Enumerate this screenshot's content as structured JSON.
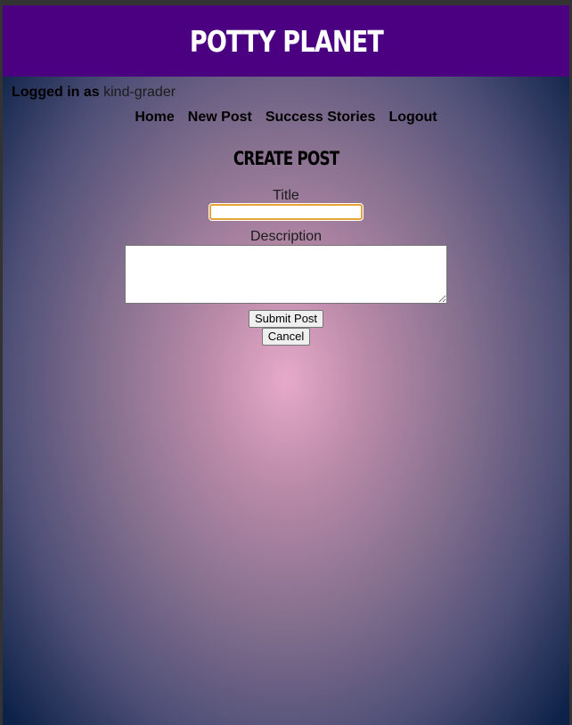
{
  "header": {
    "site_title": "Potty Planet"
  },
  "session": {
    "logged_in_label": "Logged in as",
    "username": "kind-grader"
  },
  "nav": {
    "home": "Home",
    "new_post": "New Post",
    "success_stories": "Success Stories",
    "logout": "Logout"
  },
  "page": {
    "heading": "Create Post"
  },
  "form": {
    "title_label": "Title",
    "title_value": "",
    "description_label": "Description",
    "description_value": "",
    "submit_label": "Submit Post",
    "cancel_label": "Cancel"
  },
  "colors": {
    "header_bg": "#4b0082",
    "header_text": "#ffffff",
    "gradient_center": "#e7a9c9",
    "gradient_edge": "#0d2248",
    "focus_ring": "#e8a33b"
  }
}
